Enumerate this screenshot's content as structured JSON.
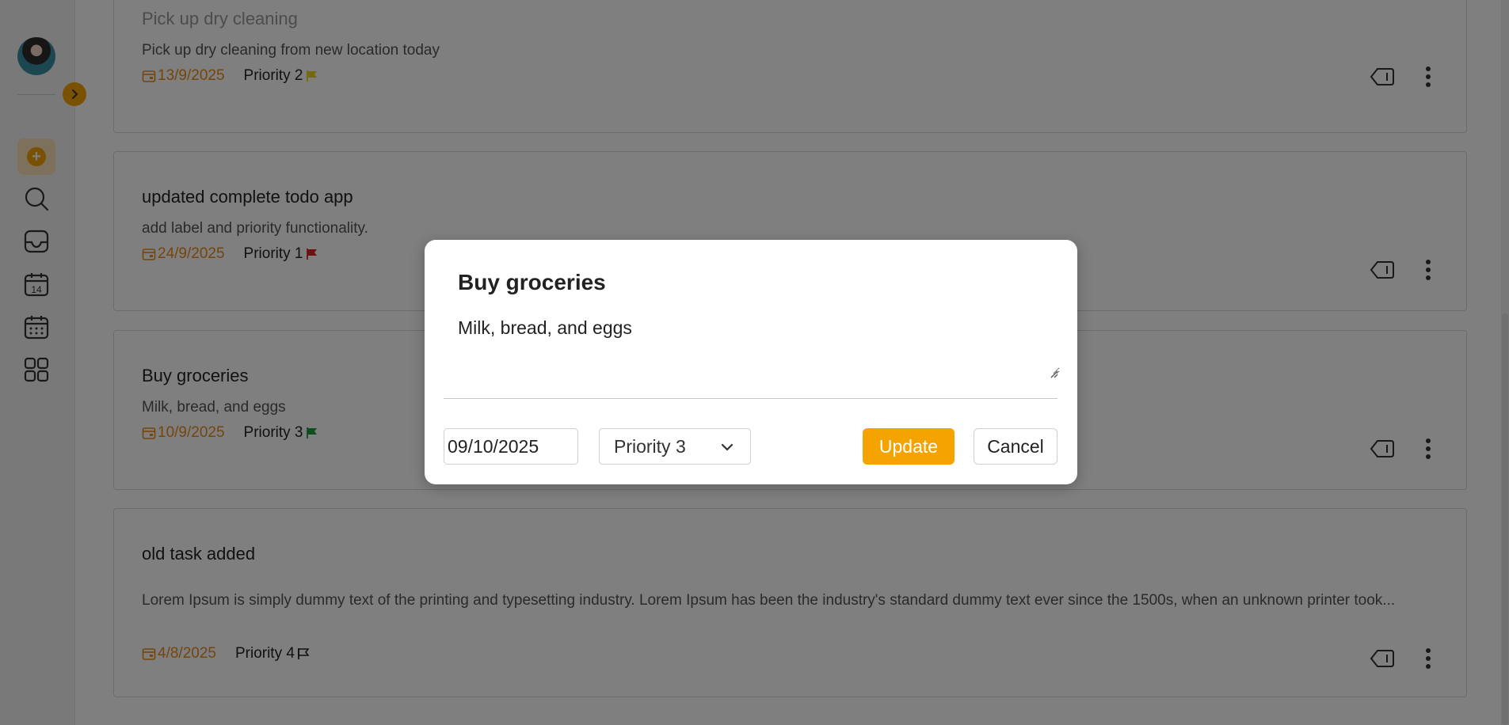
{
  "tasks": [
    {
      "title": "Pick up dry cleaning",
      "description": "Pick up dry cleaning from new location today",
      "date": "13/9/2025",
      "priority": "Priority 2",
      "flag_color": "#e8d21a"
    },
    {
      "title": "updated complete todo app",
      "description": "add label and priority functionality.",
      "date": "24/9/2025",
      "priority": "Priority 1",
      "flag_color": "#e02020"
    },
    {
      "title": "Buy groceries",
      "description": "Milk, bread, and eggs",
      "date": "10/9/2025",
      "priority": "Priority 3",
      "flag_color": "#1e9e3a"
    },
    {
      "title": "old task added",
      "description": "Lorem Ipsum is simply dummy text of the printing and typesetting industry. Lorem Ipsum has been the industry's standard dummy text ever since the 1500s, when an unknown printer took...",
      "date": "4/8/2025",
      "priority": "Priority 4",
      "flag_color": "outline"
    }
  ],
  "modal": {
    "title": "Buy groceries",
    "description": "Milk, bread, and eggs",
    "date_value": "09/10/2025",
    "priority_value": "Priority 3",
    "update_label": "Update",
    "cancel_label": "Cancel"
  },
  "colors": {
    "accent": "#f5a300",
    "date_text": "#e88a1a"
  },
  "icons": {
    "sidebar": [
      "add-icon",
      "search-icon",
      "inbox-icon",
      "calendar-today-icon",
      "calendar-upcoming-icon",
      "grid-icon"
    ],
    "header": "layout-toggle-icon",
    "task_actions": [
      "label-icon",
      "more-vertical-icon"
    ]
  }
}
